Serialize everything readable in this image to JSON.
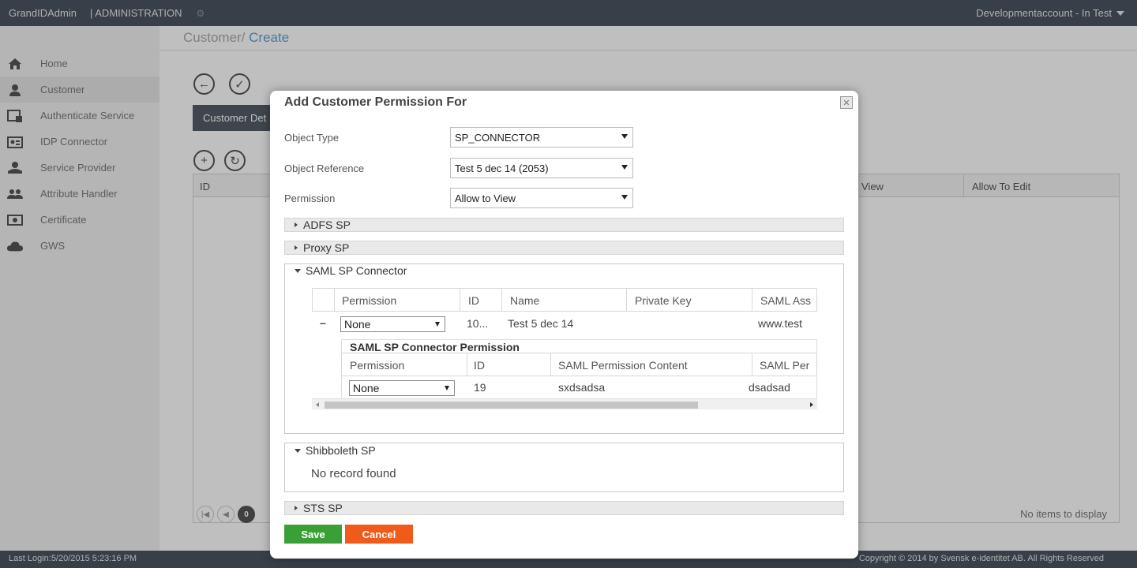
{
  "topbar": {
    "brand": "GrandIDAdmin",
    "section": "| ADMINISTRATION",
    "account": "Developmentaccount - In Test"
  },
  "sidebar": {
    "items": [
      {
        "label": "Home",
        "icon": "home-icon"
      },
      {
        "label": "Customer",
        "icon": "user-icon",
        "active": true
      },
      {
        "label": "Authenticate Service",
        "icon": "auth-service-icon"
      },
      {
        "label": "IDP Connector",
        "icon": "id-card-icon"
      },
      {
        "label": "Service Provider",
        "icon": "service-provider-icon"
      },
      {
        "label": "Attribute Handler",
        "icon": "users-icon"
      },
      {
        "label": "Certificate",
        "icon": "certificate-icon"
      },
      {
        "label": "GWS",
        "icon": "cloud-icon"
      }
    ]
  },
  "main": {
    "breadcrumb_parent": "Customer/",
    "breadcrumb_current": " Create",
    "tab_label": "Customer Det",
    "grid_headers": {
      "id": "ID",
      "view": "View",
      "edit": "Allow To Edit"
    },
    "pager_current": "0",
    "no_items": "No items to display"
  },
  "footer": {
    "last_login": "Last Login:5/20/2015 5:23:16 PM",
    "copyright": "Copyright © 2014 by Svensk e-identitet AB. All Rights Reserved"
  },
  "modal": {
    "title": "Add Customer Permission For",
    "fields": {
      "object_type_label": "Object Type",
      "object_type_value": "SP_CONNECTOR",
      "object_ref_label": "Object Reference",
      "object_ref_value": "Test 5 dec 14 (2053)",
      "permission_label": "Permission",
      "permission_value": "Allow to View"
    },
    "panels": {
      "adfs": "ADFS SP",
      "proxy": "Proxy SP",
      "saml": "SAML SP Connector",
      "shibboleth": "Shibboleth SP",
      "sts": "STS SP"
    },
    "saml_table": {
      "headers": [
        "Permission",
        "ID",
        "Name",
        "Private Key",
        "SAML Ass"
      ],
      "row": {
        "expand": "–",
        "permission": "None",
        "id": "10...",
        "name": "Test 5 dec 14",
        "saml_ass": "www.test"
      },
      "sub_title": "SAML SP Connector Permission",
      "sub_headers": [
        "Permission",
        "ID",
        "SAML Permission Content",
        "SAML Per"
      ],
      "sub_row": {
        "permission": "None",
        "id": "19",
        "content": "sxdsadsa",
        "per": "dsadsad"
      }
    },
    "shibboleth_empty": "No record found",
    "save_label": "Save",
    "cancel_label": "Cancel"
  }
}
